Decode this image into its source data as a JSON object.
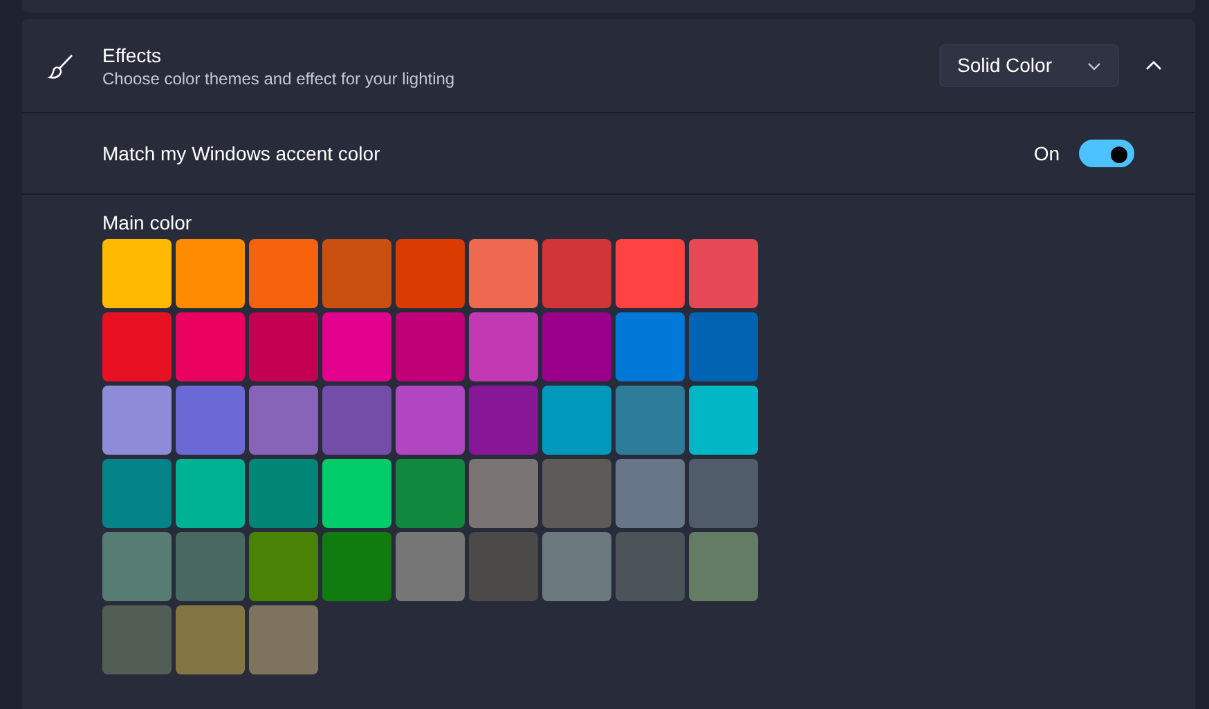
{
  "section": {
    "title": "Effects",
    "subtitle": "Choose color themes and effect for your lighting",
    "dropdown": "Solid Color",
    "expanded": true
  },
  "accent_setting": {
    "label": "Match my Windows accent color",
    "state_text": "On",
    "on": true
  },
  "main_color": {
    "label": "Main color",
    "swatches": [
      {
        "color": "#ffb900",
        "selected": false
      },
      {
        "color": "#ff8c00",
        "selected": false
      },
      {
        "color": "#f7630c",
        "selected": false
      },
      {
        "color": "#ca5010",
        "selected": false
      },
      {
        "color": "#da3b01",
        "selected": false
      },
      {
        "color": "#ef6950",
        "selected": false
      },
      {
        "color": "#d13438",
        "selected": false
      },
      {
        "color": "#ff4343",
        "selected": false
      },
      {
        "color": "#e74856",
        "selected": false
      },
      {
        "color": "#e81123",
        "selected": false
      },
      {
        "color": "#ea005e",
        "selected": false
      },
      {
        "color": "#c30052",
        "selected": false
      },
      {
        "color": "#e3008c",
        "selected": false
      },
      {
        "color": "#bf0077",
        "selected": false
      },
      {
        "color": "#c239b3",
        "selected": false
      },
      {
        "color": "#9a0089",
        "selected": false
      },
      {
        "color": "#0078d7",
        "selected": false
      },
      {
        "color": "#0063b1",
        "selected": false
      },
      {
        "color": "#8e8cd8",
        "selected": false
      },
      {
        "color": "#6b69d6",
        "selected": false
      },
      {
        "color": "#8764b8",
        "selected": false
      },
      {
        "color": "#744da9",
        "selected": false
      },
      {
        "color": "#b146c2",
        "selected": false
      },
      {
        "color": "#881798",
        "selected": false
      },
      {
        "color": "#0099bc",
        "selected": false
      },
      {
        "color": "#2d7d9a",
        "selected": false
      },
      {
        "color": "#00b7c3",
        "selected": false
      },
      {
        "color": "#038387",
        "selected": false
      },
      {
        "color": "#00b294",
        "selected": false
      },
      {
        "color": "#018574",
        "selected": false
      },
      {
        "color": "#00cc6a",
        "selected": false
      },
      {
        "color": "#10893e",
        "selected": false
      },
      {
        "color": "#7a7574",
        "selected": false
      },
      {
        "color": "#5d5a58",
        "selected": false
      },
      {
        "color": "#68768a",
        "selected": false
      },
      {
        "color": "#515c6b",
        "selected": false
      },
      {
        "color": "#567c73",
        "selected": false
      },
      {
        "color": "#486860",
        "selected": false
      },
      {
        "color": "#498205",
        "selected": false
      },
      {
        "color": "#107c10",
        "selected": false
      },
      {
        "color": "#767676",
        "selected": false
      },
      {
        "color": "#4c4a48",
        "selected": false
      },
      {
        "color": "#69797e",
        "selected": false
      },
      {
        "color": "#4a5459",
        "selected": false
      },
      {
        "color": "#647c64",
        "selected": false
      },
      {
        "color": "#525e54",
        "selected": false
      },
      {
        "color": "#847545",
        "selected": false
      },
      {
        "color": "#7e735f",
        "selected": false
      }
    ]
  }
}
